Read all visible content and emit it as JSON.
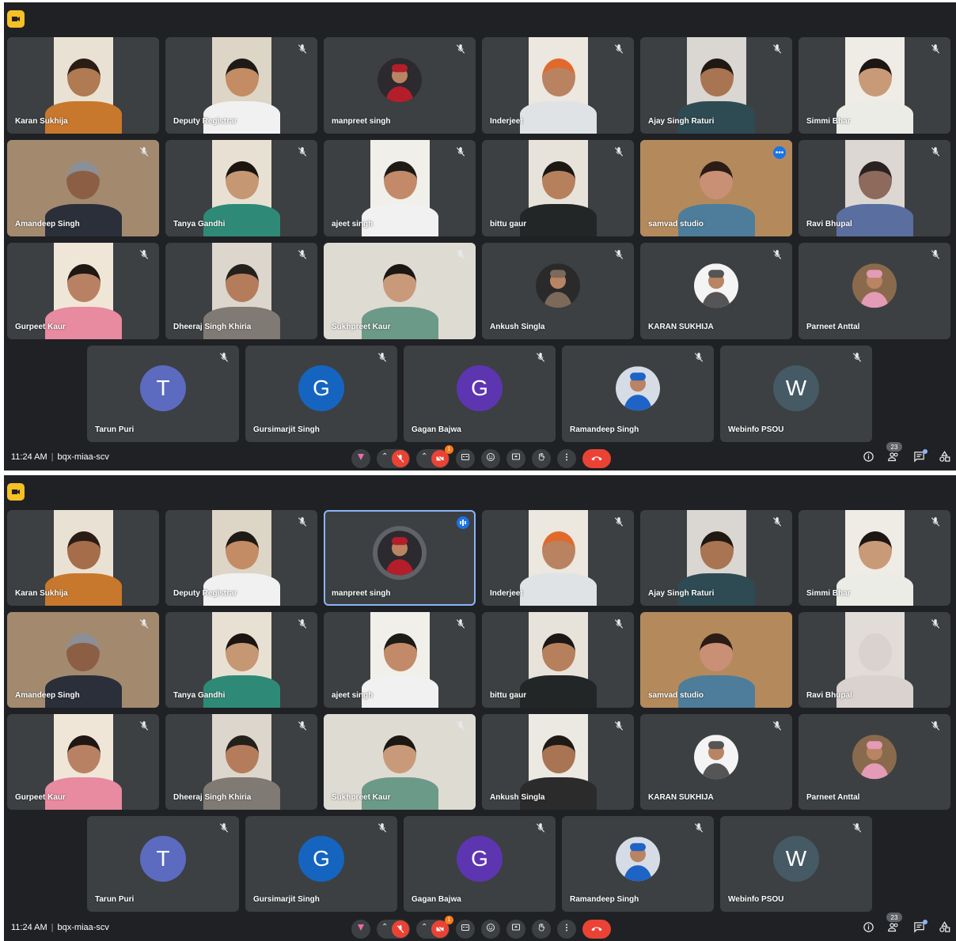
{
  "meeting": {
    "time": "11:24 AM",
    "separator": "|",
    "code": "bqx-miaa-scv",
    "people_count": "23",
    "notification_count": "1"
  },
  "colors": {
    "background": "#202124",
    "tile": "#3c4043",
    "accent_border": "#8ab4f8",
    "end_call": "#ea4335",
    "recording": "#f6c026"
  },
  "screens": [
    {
      "participants": [
        {
          "name": "Karan Sukhija",
          "muted": false,
          "kind": "video",
          "skin": "#b07a52",
          "shirt": "#c8782c",
          "bg": "#e9e2d4",
          "head": "#2b1d16"
        },
        {
          "name": "Deputy Registrar",
          "muted": true,
          "kind": "video",
          "skin": "#c48c64",
          "shirt": "#f1f1f1",
          "bg": "#ddd5c6",
          "head": "#1e1a16"
        },
        {
          "name": "manpreet singh",
          "muted": true,
          "kind": "photo",
          "photo_colors": [
            "#2c2a2f",
            "#b41e2a"
          ]
        },
        {
          "name": "Inderjeet",
          "muted": true,
          "kind": "video",
          "skin": "#b98361",
          "shirt": "#dfe3e6",
          "bg": "#ece7df",
          "head": "#e06a2c"
        },
        {
          "name": "Ajay Singh Raturi",
          "muted": true,
          "kind": "video",
          "skin": "#a97452",
          "shirt": "#2e4b53",
          "bg": "#dad6d1",
          "head": "#201813"
        },
        {
          "name": "Simmi Bhar",
          "muted": true,
          "kind": "video",
          "skin": "#c99a77",
          "shirt": "#ecece7",
          "bg": "#efebe5",
          "head": "#1d1612"
        },
        {
          "name": "Amandeep Singh",
          "muted": true,
          "kind": "video",
          "wide": true,
          "skin": "#8c5f44",
          "shirt": "#2a2f3a",
          "bg": "#a38a6f",
          "head": "#8b8f97"
        },
        {
          "name": "Tanya Gandhi",
          "muted": true,
          "kind": "video",
          "skin": "#c69773",
          "shirt": "#2e8a77",
          "bg": "#e8e1d3",
          "head": "#1b1410"
        },
        {
          "name": "ajeet singh",
          "muted": true,
          "kind": "video",
          "skin": "#c28a68",
          "shirt": "#f1f1f1",
          "bg": "#f1efe9",
          "head": "#1e1a16"
        },
        {
          "name": "bittu gaur",
          "muted": true,
          "kind": "video",
          "skin": "#b7805d",
          "shirt": "#232627",
          "bg": "#e8e3da",
          "head": "#1b1714"
        },
        {
          "name": "samvad studio",
          "muted": false,
          "kind": "video",
          "wide": true,
          "active": true,
          "skin": "#c99075",
          "shirt": "#4d7d9a",
          "bg": "#b48a5c",
          "head": "#2c1c15"
        },
        {
          "name": "Ravi Bhupal",
          "muted": true,
          "kind": "video",
          "skin": "#8d6a5c",
          "shirt": "#5a6fa0",
          "bg": "#ddd7d3",
          "head": "#2a2222"
        },
        {
          "name": "Gurpeet Kaur",
          "muted": true,
          "kind": "video",
          "skin": "#b98163",
          "shirt": "#e88aa0",
          "bg": "#efe6d8",
          "head": "#1f1713"
        },
        {
          "name": "Dheeraj Singh Khiria",
          "muted": true,
          "kind": "video",
          "skin": "#b57c5c",
          "shirt": "#7f7a73",
          "bg": "#dcd6cc",
          "head": "#24201c"
        },
        {
          "name": "Sukhpreet Kaur",
          "muted": true,
          "kind": "video",
          "wide": true,
          "skin": "#c99a7a",
          "shirt": "#6c9a88",
          "bg": "#dedbd3",
          "head": "#1c1713"
        },
        {
          "name": "Ankush Singla",
          "muted": true,
          "kind": "photo",
          "photo_colors": [
            "#2a2a2a",
            "#7b6a5a"
          ]
        },
        {
          "name": "KARAN SUKHIJA",
          "muted": true,
          "kind": "photo",
          "photo_colors": [
            "#f4f4f4",
            "#555555"
          ]
        },
        {
          "name": "Parneet Anttal",
          "muted": true,
          "kind": "photo",
          "photo_colors": [
            "#8a6a4c",
            "#e39bb6"
          ]
        },
        {
          "name": "Tarun Puri",
          "muted": true,
          "kind": "letter",
          "letter": "T",
          "color": "#5c6bc0"
        },
        {
          "name": "Gursimarjit Singh",
          "muted": true,
          "kind": "letter",
          "letter": "G",
          "color": "#1565c0"
        },
        {
          "name": "Gagan Bajwa",
          "muted": true,
          "kind": "letter",
          "letter": "G",
          "color": "#5e35b1"
        },
        {
          "name": "Ramandeep Singh",
          "muted": true,
          "kind": "photo",
          "photo_colors": [
            "#d6dce6",
            "#1e63c6"
          ]
        },
        {
          "name": "Webinfo PSOU",
          "muted": true,
          "kind": "letter",
          "letter": "W",
          "color": "#455a64"
        }
      ]
    },
    {
      "participants": [
        {
          "name": "Karan Sukhija",
          "muted": false,
          "kind": "video",
          "skin": "#a66d4b",
          "shirt": "#c8782c",
          "bg": "#e9e2d4",
          "head": "#2b1d16"
        },
        {
          "name": "Deputy Registrar",
          "muted": true,
          "kind": "video",
          "skin": "#c48c64",
          "shirt": "#f1f1f1",
          "bg": "#ddd5c6",
          "head": "#1e1a16"
        },
        {
          "name": "manpreet singh",
          "muted": false,
          "kind": "photo",
          "active": true,
          "speaking": true,
          "photo_colors": [
            "#2c2a2f",
            "#b41e2a"
          ]
        },
        {
          "name": "Inderjeet",
          "muted": true,
          "kind": "video",
          "skin": "#b98361",
          "shirt": "#dfe3e6",
          "bg": "#ece7df",
          "head": "#e06a2c"
        },
        {
          "name": "Ajay Singh Raturi",
          "muted": true,
          "kind": "video",
          "skin": "#a97452",
          "shirt": "#2e4b53",
          "bg": "#dad6d1",
          "head": "#201813"
        },
        {
          "name": "Simmi Bhar",
          "muted": true,
          "kind": "video",
          "skin": "#c99a77",
          "shirt": "#ecece7",
          "bg": "#efebe5",
          "head": "#1d1612"
        },
        {
          "name": "Amandeep Singh",
          "muted": true,
          "kind": "video",
          "wide": true,
          "skin": "#8c5f44",
          "shirt": "#2a2f3a",
          "bg": "#a38a6f",
          "head": "#8b8f97"
        },
        {
          "name": "Tanya Gandhi",
          "muted": true,
          "kind": "video",
          "skin": "#c69773",
          "shirt": "#2e8a77",
          "bg": "#e8e1d3",
          "head": "#1b1410"
        },
        {
          "name": "ajeet singh",
          "muted": true,
          "kind": "video",
          "skin": "#c28a68",
          "shirt": "#f1f1f1",
          "bg": "#f1efe9",
          "head": "#1e1a16"
        },
        {
          "name": "bittu gaur",
          "muted": true,
          "kind": "video",
          "skin": "#b7805d",
          "shirt": "#232627",
          "bg": "#e8e3da",
          "head": "#1b1714"
        },
        {
          "name": "samvad studio",
          "muted": false,
          "kind": "video",
          "wide": true,
          "skin": "#c99075",
          "shirt": "#4d7d9a",
          "bg": "#b48a5c",
          "head": "#2c1c15"
        },
        {
          "name": "Ravi Bhupal",
          "muted": true,
          "kind": "video",
          "skin": "#d9d2ce",
          "shirt": "#d9d2ce",
          "bg": "#e2dcd8",
          "head": "#d9d2ce"
        },
        {
          "name": "Gurpeet Kaur",
          "muted": true,
          "kind": "video",
          "skin": "#b98163",
          "shirt": "#e88aa0",
          "bg": "#efe6d8",
          "head": "#1f1713"
        },
        {
          "name": "Dheeraj Singh Khiria",
          "muted": true,
          "kind": "video",
          "skin": "#b57c5c",
          "shirt": "#7f7a73",
          "bg": "#dcd6cc",
          "head": "#24201c"
        },
        {
          "name": "Sukhpreet Kaur",
          "muted": true,
          "kind": "video",
          "wide": true,
          "skin": "#c99a7a",
          "shirt": "#6c9a88",
          "bg": "#dedbd3",
          "head": "#1c1713"
        },
        {
          "name": "Ankush Singla",
          "muted": true,
          "kind": "video",
          "skin": "#a97453",
          "shirt": "#2b2b2b",
          "bg": "#ece8e2",
          "head": "#1f1a16"
        },
        {
          "name": "KARAN SUKHIJA",
          "muted": true,
          "kind": "photo",
          "photo_colors": [
            "#f4f4f4",
            "#555555"
          ]
        },
        {
          "name": "Parneet Anttal",
          "muted": true,
          "kind": "photo",
          "photo_colors": [
            "#8a6a4c",
            "#e39bb6"
          ]
        },
        {
          "name": "Tarun Puri",
          "muted": true,
          "kind": "letter",
          "letter": "T",
          "color": "#5c6bc0"
        },
        {
          "name": "Gursimarjit Singh",
          "muted": true,
          "kind": "letter",
          "letter": "G",
          "color": "#1565c0"
        },
        {
          "name": "Gagan Bajwa",
          "muted": true,
          "kind": "letter",
          "letter": "G",
          "color": "#5e35b1"
        },
        {
          "name": "Ramandeep Singh",
          "muted": true,
          "kind": "photo",
          "photo_colors": [
            "#d6dce6",
            "#1e63c6"
          ]
        },
        {
          "name": "Webinfo PSOU",
          "muted": true,
          "kind": "letter",
          "letter": "W",
          "color": "#455a64"
        }
      ]
    }
  ],
  "controls": [
    {
      "icon": "reaction-icon"
    },
    {
      "icon": "microphone-off-icon"
    },
    {
      "icon": "camera-off-icon"
    },
    {
      "icon": "captions-icon"
    },
    {
      "icon": "emoji-icon"
    },
    {
      "icon": "present-screen-icon"
    },
    {
      "icon": "raise-hand-icon"
    },
    {
      "icon": "more-options-icon"
    },
    {
      "icon": "end-call-icon"
    }
  ],
  "right_icons": [
    {
      "icon": "info-icon"
    },
    {
      "icon": "people-icon"
    },
    {
      "icon": "chat-icon"
    },
    {
      "icon": "activities-icon"
    }
  ]
}
